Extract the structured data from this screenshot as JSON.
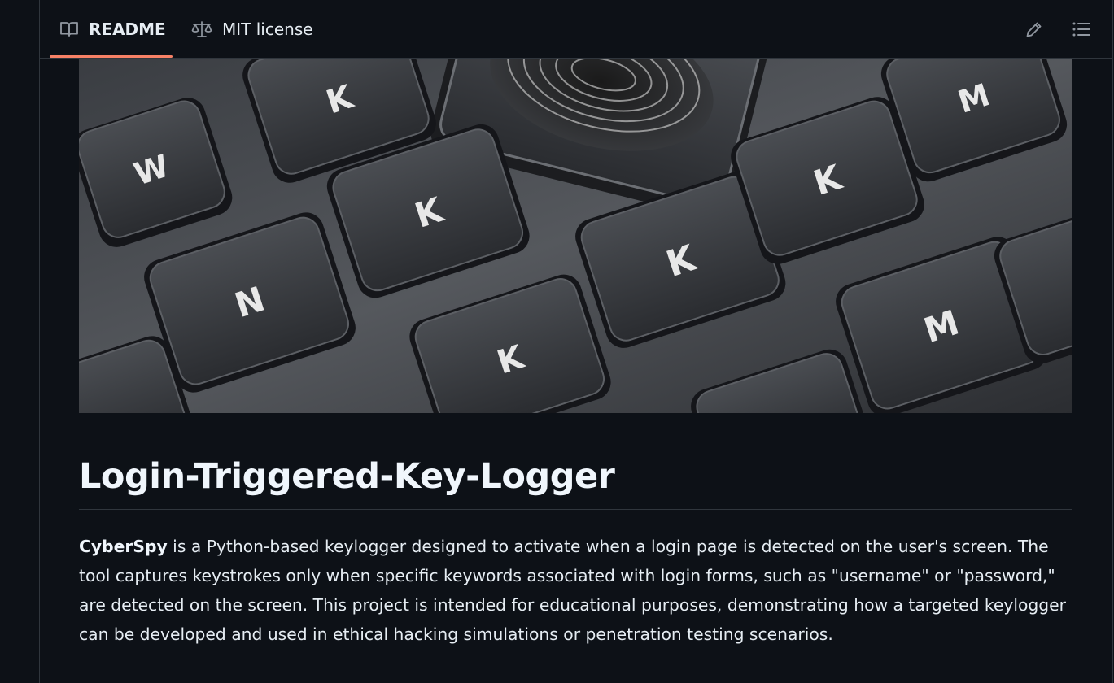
{
  "tabs": {
    "readme_label": "README",
    "license_label": "MIT license",
    "readme_icon": "book-icon",
    "license_icon": "scale-icon"
  },
  "toolbar": {
    "edit_icon": "pencil-icon",
    "outline_icon": "list-icon"
  },
  "readme": {
    "hero_keycaps": [
      "W",
      "K",
      "N",
      "K",
      "K",
      "K",
      "K",
      "M",
      "M"
    ],
    "title": "Login-Triggered-Key-Logger",
    "description_bold": "CyberSpy",
    "description_rest": " is a Python-based keylogger designed to activate when a login page is detected on the user's screen. The tool captures keystrokes only when specific keywords associated with login forms, such as \"username\" or \"password,\" are detected on the screen. This project is intended for educational purposes, demonstrating how a targeted keylogger can be developed and used in ethical hacking simulations or penetration testing scenarios."
  },
  "colors": {
    "background": "#0d1117",
    "border": "#30363d",
    "active_tab_underline": "#f78166",
    "text": "#e6edf3"
  }
}
